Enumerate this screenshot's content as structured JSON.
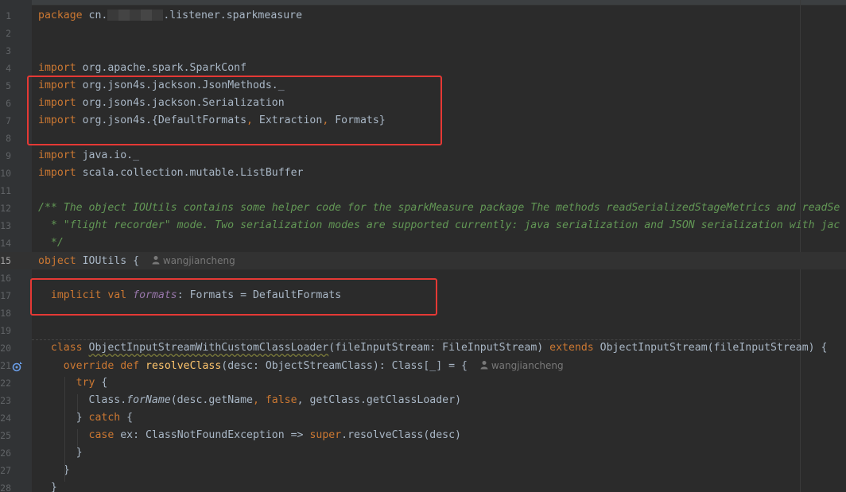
{
  "editor": {
    "lines": [
      {
        "n": "1",
        "tokens": [
          {
            "t": "package",
            "c": "kw"
          },
          {
            "t": " cn."
          },
          {
            "blur": true
          },
          {
            "t": ".listener.sparkmeasure"
          }
        ]
      },
      {
        "n": "2",
        "tokens": []
      },
      {
        "n": "3",
        "tokens": []
      },
      {
        "n": "4",
        "tokens": [
          {
            "t": "import",
            "c": "kw"
          },
          {
            "t": " org.apache.spark.SparkConf"
          }
        ]
      },
      {
        "n": "5",
        "tokens": [
          {
            "t": "import",
            "c": "kw"
          },
          {
            "t": " org.json4s.jackson.JsonMethods._"
          }
        ]
      },
      {
        "n": "6",
        "tokens": [
          {
            "t": "import",
            "c": "kw"
          },
          {
            "t": " org.json4s.jackson.Serialization"
          }
        ]
      },
      {
        "n": "7",
        "tokens": [
          {
            "t": "import",
            "c": "kw"
          },
          {
            "t": " org.json4s.{DefaultFormats"
          },
          {
            "t": ",",
            "c": "kw"
          },
          {
            "t": " Extraction"
          },
          {
            "t": ",",
            "c": "kw"
          },
          {
            "t": " Formats}"
          }
        ]
      },
      {
        "n": "8",
        "tokens": []
      },
      {
        "n": "9",
        "tokens": [
          {
            "t": "import",
            "c": "kw"
          },
          {
            "t": " java.io._"
          }
        ]
      },
      {
        "n": "10",
        "tokens": [
          {
            "t": "import",
            "c": "kw"
          },
          {
            "t": " scala.collection.mutable.ListBuffer"
          }
        ]
      },
      {
        "n": "11",
        "tokens": []
      },
      {
        "n": "12",
        "tokens": [
          {
            "t": "/** The object IOUtils contains some helper code for the sparkMeasure package The methods readSerializedStageMetrics and readSe",
            "c": "cm"
          }
        ]
      },
      {
        "n": "13",
        "tokens": [
          {
            "t": "  * \"flight recorder\" mode. Two serialization modes are supported currently: java serialization and JSON serialization with jac",
            "c": "cm"
          }
        ]
      },
      {
        "n": "14",
        "tokens": [
          {
            "t": "  */",
            "c": "cm"
          }
        ]
      },
      {
        "n": "15",
        "current": true,
        "tokens": [
          {
            "t": "object",
            "c": "kw"
          },
          {
            "t": " IOUtils {  "
          },
          {
            "hint": "wangjiancheng"
          }
        ]
      },
      {
        "n": "16",
        "tokens": []
      },
      {
        "n": "17",
        "tokens": [
          {
            "t": "  "
          },
          {
            "t": "implicit val",
            "c": "kw"
          },
          {
            "t": " "
          },
          {
            "t": "formats",
            "c": "it"
          },
          {
            "t": ": Formats = DefaultFormats"
          }
        ]
      },
      {
        "n": "18",
        "tokens": []
      },
      {
        "n": "19",
        "tokens": []
      },
      {
        "n": "20",
        "tokens": [
          {
            "t": "  "
          },
          {
            "t": "class",
            "c": "kw"
          },
          {
            "t": " "
          },
          {
            "t": "ObjectInputStreamWithCustomClassLoader",
            "c": "sq"
          },
          {
            "t": "(fileInputStream: FileInputStream) "
          },
          {
            "t": "extends",
            "c": "kw"
          },
          {
            "t": " ObjectInputStream(fileInputStream) {"
          }
        ]
      },
      {
        "n": "21",
        "tokens": [
          {
            "t": "    "
          },
          {
            "t": "override def",
            "c": "kw"
          },
          {
            "t": " "
          },
          {
            "t": "resolveClass",
            "c": "fn"
          },
          {
            "t": "(desc: ObjectStreamClass): Class[_] = {  "
          },
          {
            "hint": "wangjiancheng"
          }
        ]
      },
      {
        "n": "22",
        "tokens": [
          {
            "t": "      "
          },
          {
            "t": "try",
            "c": "kw"
          },
          {
            "t": " {"
          }
        ]
      },
      {
        "n": "23",
        "tokens": [
          {
            "t": "        Class."
          },
          {
            "t": "forName",
            "c": "sfn"
          },
          {
            "t": "(desc.getName"
          },
          {
            "t": ",",
            "c": "kw"
          },
          {
            "t": " "
          },
          {
            "t": "false",
            "c": "kw"
          },
          {
            "t": ","
          },
          {
            "t": " getClass.getClassLoader)"
          }
        ]
      },
      {
        "n": "24",
        "tokens": [
          {
            "t": "      } "
          },
          {
            "t": "catch",
            "c": "kw"
          },
          {
            "t": " {"
          }
        ]
      },
      {
        "n": "25",
        "tokens": [
          {
            "t": "        "
          },
          {
            "t": "case",
            "c": "kw"
          },
          {
            "t": " ex: ClassNotFoundException => "
          },
          {
            "t": "super",
            "c": "kw"
          },
          {
            "t": ".resolveClass(desc)"
          }
        ]
      },
      {
        "n": "26",
        "tokens": [
          {
            "t": "      }"
          }
        ]
      },
      {
        "n": "27",
        "tokens": [
          {
            "t": "    }"
          }
        ]
      },
      {
        "n": "28",
        "tokens": [
          {
            "t": "  }"
          }
        ]
      }
    ]
  },
  "colors": {
    "background": "#2b2b2b",
    "keyword": "#cc7832",
    "comment": "#629755",
    "function": "#ffc66d",
    "field": "#9876aa",
    "highlight_box": "#e53935"
  },
  "icons": [
    "person-icon",
    "override-method-icon"
  ]
}
